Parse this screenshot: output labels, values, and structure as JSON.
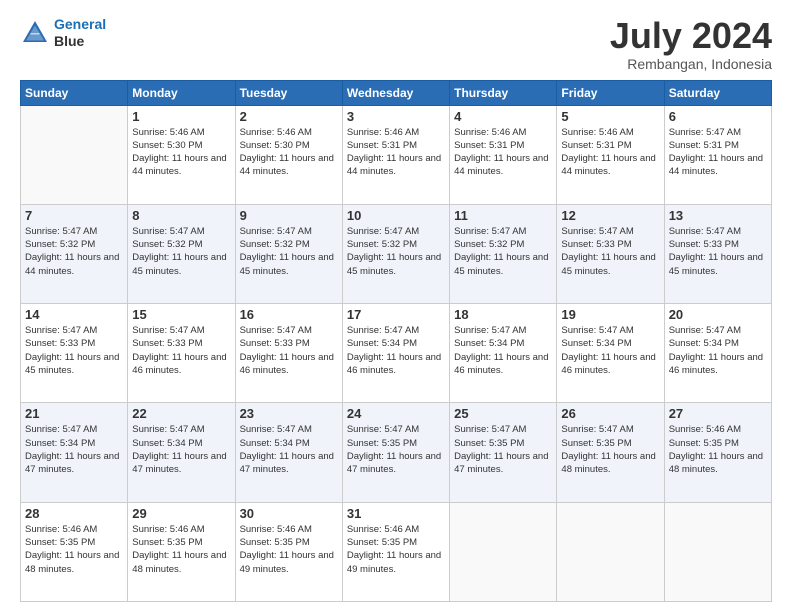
{
  "header": {
    "logo_line1": "General",
    "logo_line2": "Blue",
    "title": "July 2024",
    "subtitle": "Rembangan, Indonesia"
  },
  "days_of_week": [
    "Sunday",
    "Monday",
    "Tuesday",
    "Wednesday",
    "Thursday",
    "Friday",
    "Saturday"
  ],
  "weeks": [
    [
      {
        "day": "",
        "sunrise": "",
        "sunset": "",
        "daylight": ""
      },
      {
        "day": "1",
        "sunrise": "Sunrise: 5:46 AM",
        "sunset": "Sunset: 5:30 PM",
        "daylight": "Daylight: 11 hours and 44 minutes."
      },
      {
        "day": "2",
        "sunrise": "Sunrise: 5:46 AM",
        "sunset": "Sunset: 5:30 PM",
        "daylight": "Daylight: 11 hours and 44 minutes."
      },
      {
        "day": "3",
        "sunrise": "Sunrise: 5:46 AM",
        "sunset": "Sunset: 5:31 PM",
        "daylight": "Daylight: 11 hours and 44 minutes."
      },
      {
        "day": "4",
        "sunrise": "Sunrise: 5:46 AM",
        "sunset": "Sunset: 5:31 PM",
        "daylight": "Daylight: 11 hours and 44 minutes."
      },
      {
        "day": "5",
        "sunrise": "Sunrise: 5:46 AM",
        "sunset": "Sunset: 5:31 PM",
        "daylight": "Daylight: 11 hours and 44 minutes."
      },
      {
        "day": "6",
        "sunrise": "Sunrise: 5:47 AM",
        "sunset": "Sunset: 5:31 PM",
        "daylight": "Daylight: 11 hours and 44 minutes."
      }
    ],
    [
      {
        "day": "7",
        "sunrise": "Sunrise: 5:47 AM",
        "sunset": "Sunset: 5:32 PM",
        "daylight": "Daylight: 11 hours and 44 minutes."
      },
      {
        "day": "8",
        "sunrise": "Sunrise: 5:47 AM",
        "sunset": "Sunset: 5:32 PM",
        "daylight": "Daylight: 11 hours and 45 minutes."
      },
      {
        "day": "9",
        "sunrise": "Sunrise: 5:47 AM",
        "sunset": "Sunset: 5:32 PM",
        "daylight": "Daylight: 11 hours and 45 minutes."
      },
      {
        "day": "10",
        "sunrise": "Sunrise: 5:47 AM",
        "sunset": "Sunset: 5:32 PM",
        "daylight": "Daylight: 11 hours and 45 minutes."
      },
      {
        "day": "11",
        "sunrise": "Sunrise: 5:47 AM",
        "sunset": "Sunset: 5:32 PM",
        "daylight": "Daylight: 11 hours and 45 minutes."
      },
      {
        "day": "12",
        "sunrise": "Sunrise: 5:47 AM",
        "sunset": "Sunset: 5:33 PM",
        "daylight": "Daylight: 11 hours and 45 minutes."
      },
      {
        "day": "13",
        "sunrise": "Sunrise: 5:47 AM",
        "sunset": "Sunset: 5:33 PM",
        "daylight": "Daylight: 11 hours and 45 minutes."
      }
    ],
    [
      {
        "day": "14",
        "sunrise": "Sunrise: 5:47 AM",
        "sunset": "Sunset: 5:33 PM",
        "daylight": "Daylight: 11 hours and 45 minutes."
      },
      {
        "day": "15",
        "sunrise": "Sunrise: 5:47 AM",
        "sunset": "Sunset: 5:33 PM",
        "daylight": "Daylight: 11 hours and 46 minutes."
      },
      {
        "day": "16",
        "sunrise": "Sunrise: 5:47 AM",
        "sunset": "Sunset: 5:33 PM",
        "daylight": "Daylight: 11 hours and 46 minutes."
      },
      {
        "day": "17",
        "sunrise": "Sunrise: 5:47 AM",
        "sunset": "Sunset: 5:34 PM",
        "daylight": "Daylight: 11 hours and 46 minutes."
      },
      {
        "day": "18",
        "sunrise": "Sunrise: 5:47 AM",
        "sunset": "Sunset: 5:34 PM",
        "daylight": "Daylight: 11 hours and 46 minutes."
      },
      {
        "day": "19",
        "sunrise": "Sunrise: 5:47 AM",
        "sunset": "Sunset: 5:34 PM",
        "daylight": "Daylight: 11 hours and 46 minutes."
      },
      {
        "day": "20",
        "sunrise": "Sunrise: 5:47 AM",
        "sunset": "Sunset: 5:34 PM",
        "daylight": "Daylight: 11 hours and 46 minutes."
      }
    ],
    [
      {
        "day": "21",
        "sunrise": "Sunrise: 5:47 AM",
        "sunset": "Sunset: 5:34 PM",
        "daylight": "Daylight: 11 hours and 47 minutes."
      },
      {
        "day": "22",
        "sunrise": "Sunrise: 5:47 AM",
        "sunset": "Sunset: 5:34 PM",
        "daylight": "Daylight: 11 hours and 47 minutes."
      },
      {
        "day": "23",
        "sunrise": "Sunrise: 5:47 AM",
        "sunset": "Sunset: 5:34 PM",
        "daylight": "Daylight: 11 hours and 47 minutes."
      },
      {
        "day": "24",
        "sunrise": "Sunrise: 5:47 AM",
        "sunset": "Sunset: 5:35 PM",
        "daylight": "Daylight: 11 hours and 47 minutes."
      },
      {
        "day": "25",
        "sunrise": "Sunrise: 5:47 AM",
        "sunset": "Sunset: 5:35 PM",
        "daylight": "Daylight: 11 hours and 47 minutes."
      },
      {
        "day": "26",
        "sunrise": "Sunrise: 5:47 AM",
        "sunset": "Sunset: 5:35 PM",
        "daylight": "Daylight: 11 hours and 48 minutes."
      },
      {
        "day": "27",
        "sunrise": "Sunrise: 5:46 AM",
        "sunset": "Sunset: 5:35 PM",
        "daylight": "Daylight: 11 hours and 48 minutes."
      }
    ],
    [
      {
        "day": "28",
        "sunrise": "Sunrise: 5:46 AM",
        "sunset": "Sunset: 5:35 PM",
        "daylight": "Daylight: 11 hours and 48 minutes."
      },
      {
        "day": "29",
        "sunrise": "Sunrise: 5:46 AM",
        "sunset": "Sunset: 5:35 PM",
        "daylight": "Daylight: 11 hours and 48 minutes."
      },
      {
        "day": "30",
        "sunrise": "Sunrise: 5:46 AM",
        "sunset": "Sunset: 5:35 PM",
        "daylight": "Daylight: 11 hours and 49 minutes."
      },
      {
        "day": "31",
        "sunrise": "Sunrise: 5:46 AM",
        "sunset": "Sunset: 5:35 PM",
        "daylight": "Daylight: 11 hours and 49 minutes."
      },
      {
        "day": "",
        "sunrise": "",
        "sunset": "",
        "daylight": ""
      },
      {
        "day": "",
        "sunrise": "",
        "sunset": "",
        "daylight": ""
      },
      {
        "day": "",
        "sunrise": "",
        "sunset": "",
        "daylight": ""
      }
    ]
  ]
}
